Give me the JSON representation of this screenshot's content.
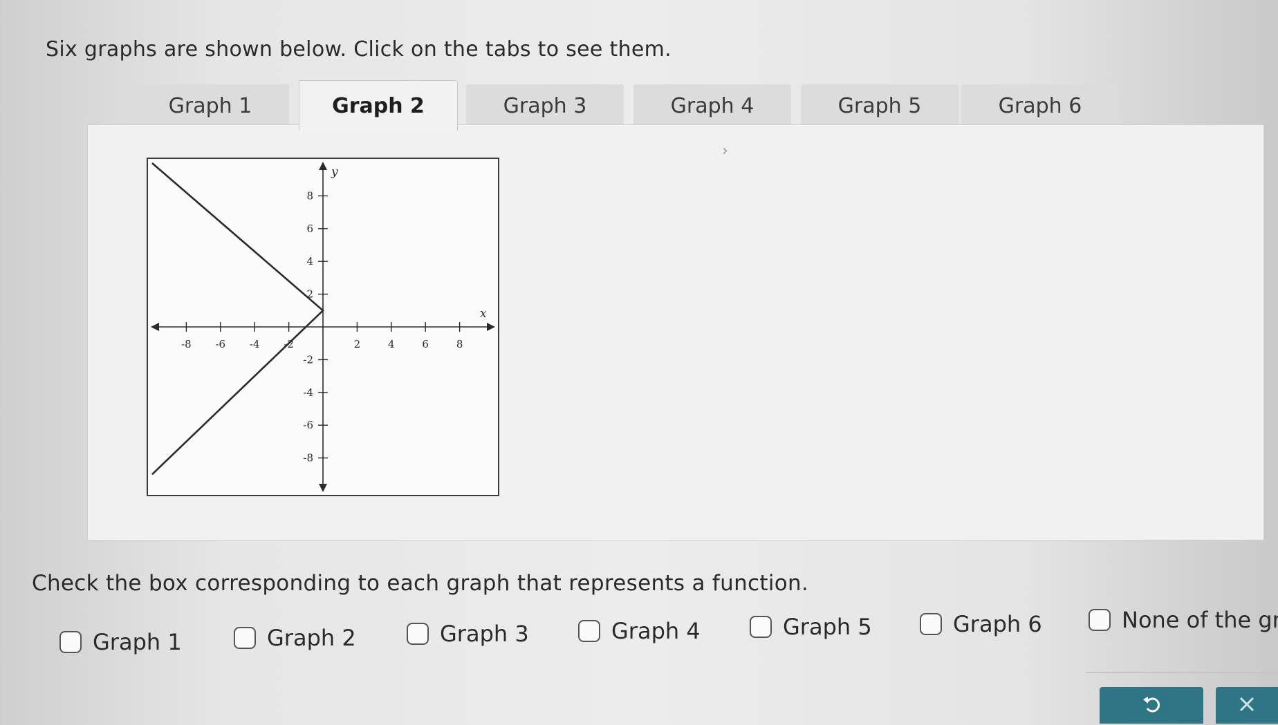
{
  "instructions": "Six graphs are shown below. Click on the tabs to see them.",
  "tabs": [
    {
      "label": "Graph 1",
      "active": false
    },
    {
      "label": "Graph 2",
      "active": true
    },
    {
      "label": "Graph 3",
      "active": false
    },
    {
      "label": "Graph 4",
      "active": false
    },
    {
      "label": "Graph 5",
      "active": false
    },
    {
      "label": "Graph 6",
      "active": false
    }
  ],
  "chart_data": {
    "type": "line",
    "xlabel": "x",
    "ylabel": "y",
    "xlim": [
      -10,
      10
    ],
    "ylim": [
      -10,
      10
    ],
    "x_ticks": [
      -8,
      -6,
      -4,
      -2,
      2,
      4,
      6,
      8
    ],
    "y_ticks": [
      8,
      6,
      4,
      2,
      -2,
      -4,
      -6,
      -8
    ],
    "series": [
      {
        "x": [
          -10,
          0,
          -10
        ],
        "y": [
          10,
          1,
          -9
        ]
      }
    ]
  },
  "question": "Check the box corresponding to each graph that represents a function.",
  "options": [
    {
      "label": "Graph 1",
      "checked": false
    },
    {
      "label": "Graph 2",
      "checked": false
    },
    {
      "label": "Graph 3",
      "checked": false
    },
    {
      "label": "Graph 4",
      "checked": false
    },
    {
      "label": "Graph 5",
      "checked": false
    },
    {
      "label": "Graph 6",
      "checked": false
    },
    {
      "label": "None of the gr",
      "checked": false
    }
  ],
  "buttons": {
    "undo_icon": "undo-icon",
    "clear_icon": "close-icon"
  },
  "colors": {
    "accent": "#2f7585",
    "graph_line": "#2a2a2a"
  }
}
